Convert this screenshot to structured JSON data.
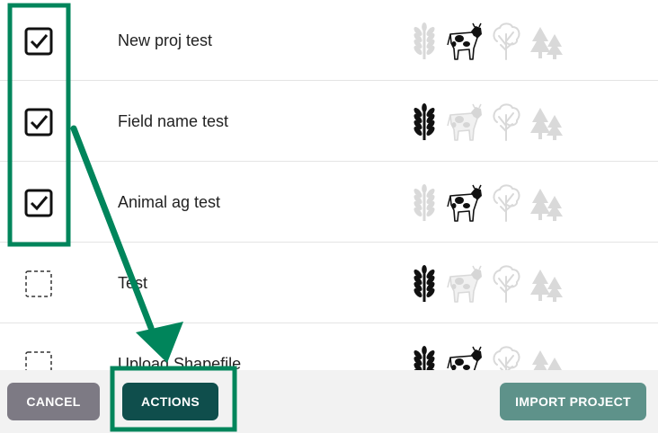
{
  "projects": [
    {
      "name": "New proj test",
      "checked": true,
      "active": [
        "cow"
      ]
    },
    {
      "name": "Field name test",
      "checked": true,
      "active": [
        "wheat"
      ]
    },
    {
      "name": "Animal ag test",
      "checked": true,
      "active": [
        "cow"
      ]
    },
    {
      "name": "Test",
      "checked": false,
      "active": [
        "wheat"
      ]
    },
    {
      "name": "Upload Shapefile",
      "checked": false,
      "active": [
        "wheat",
        "cow"
      ]
    }
  ],
  "footer": {
    "cancel_label": "CANCEL",
    "actions_label": "ACTIONS",
    "import_label": "IMPORT PROJECT"
  },
  "colors": {
    "active_icon": "#111111",
    "inactive_icon": "#d9d9d9",
    "annotation": "#00855b"
  }
}
